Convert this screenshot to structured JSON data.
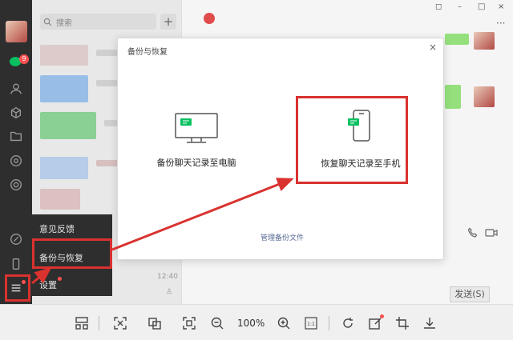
{
  "search": {
    "placeholder": "搜索"
  },
  "sidebar": {
    "badge_count": "9"
  },
  "menu": {
    "items": [
      {
        "label": "意见反馈"
      },
      {
        "label": "备份与恢复"
      },
      {
        "label": "设置"
      }
    ]
  },
  "dialog": {
    "title": "备份与恢复",
    "close": "×",
    "option_pc": "备份聊天记录至电脑",
    "option_phone": "恢复聊天记录至手机",
    "manage_link": "管理备份文件"
  },
  "chat": {
    "time": "12:40",
    "send_label": "发送(S)"
  },
  "toolbar": {
    "zoom": "100%"
  },
  "colors": {
    "accent_green": "#07c160",
    "highlight_red": "#d9322f",
    "link": "#576b95"
  }
}
